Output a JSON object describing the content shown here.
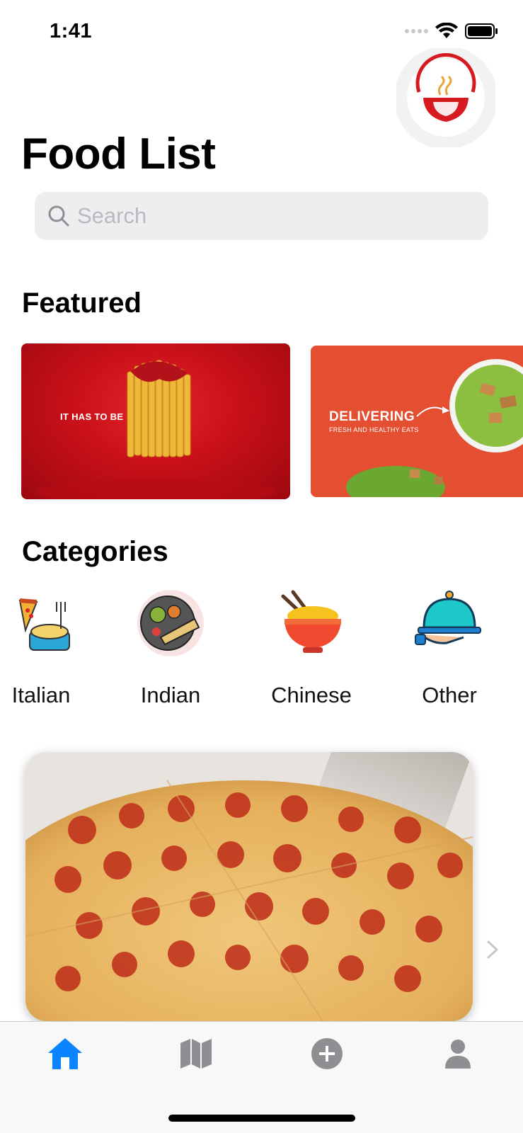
{
  "status_bar": {
    "time": "1:41"
  },
  "header": {
    "title": "Food List",
    "logo_icon": "noodle-bowl-logo-icon"
  },
  "search": {
    "placeholder": "Search",
    "value": ""
  },
  "featured": {
    "title": "Featured",
    "cards": [
      {
        "text": "IT HAS TO BE",
        "image": "fries-banner"
      },
      {
        "text": "DELIVERING",
        "subtext": "FRESH AND HEALTHY EATS",
        "image": "salad-banner"
      }
    ]
  },
  "categories": {
    "title": "Categories",
    "items": [
      {
        "label": "Italian",
        "icon": "italian-food-icon"
      },
      {
        "label": "Indian",
        "icon": "indian-food-icon"
      },
      {
        "label": "Chinese",
        "icon": "chinese-noodles-icon"
      },
      {
        "label": "Other",
        "icon": "serving-cloche-icon"
      }
    ]
  },
  "food_card": {
    "image": "pepperoni-pizza-photo"
  },
  "tab_bar": {
    "items": [
      {
        "name": "home",
        "icon": "home-icon",
        "selected": true
      },
      {
        "name": "map",
        "icon": "map-icon",
        "selected": false
      },
      {
        "name": "add",
        "icon": "plus-circle-icon",
        "selected": false
      },
      {
        "name": "profile",
        "icon": "person-icon",
        "selected": false
      }
    ]
  },
  "colors": {
    "accent": "#0a84ff",
    "tab_inactive": "#8e8e93",
    "search_bg": "#eeeef0",
    "fries_banner": "#c81018",
    "salad_banner": "#e44e31"
  }
}
